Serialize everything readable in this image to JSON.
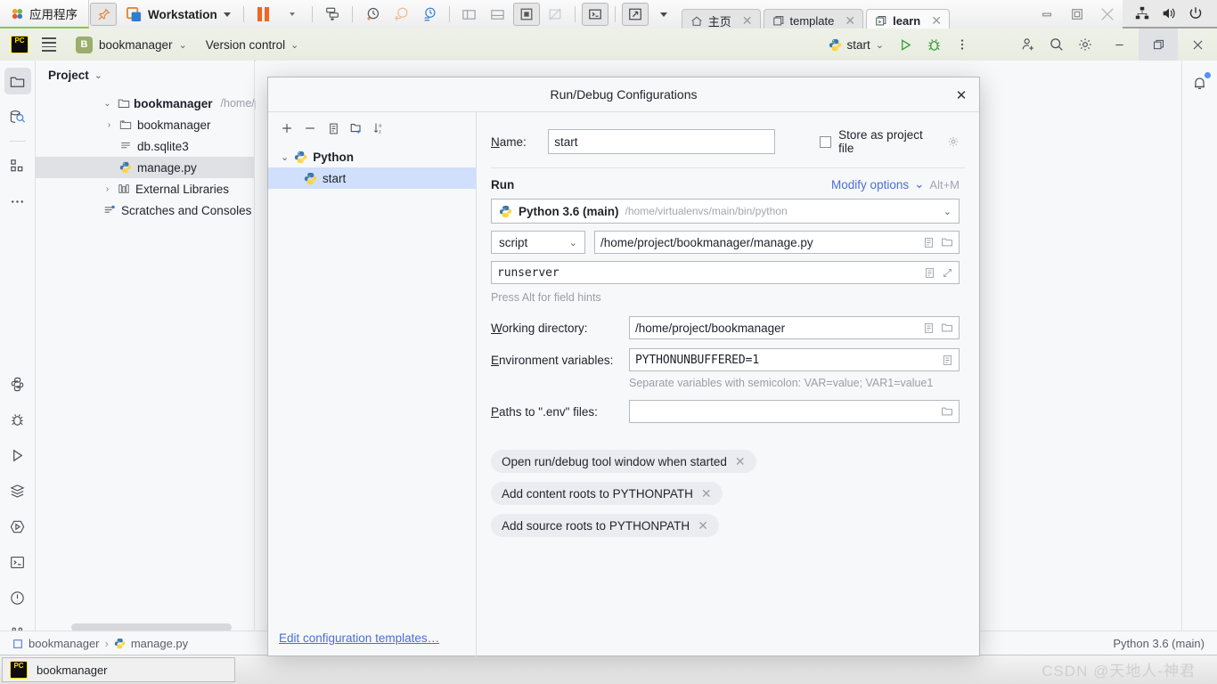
{
  "vmware": {
    "apps_label": "应用程序",
    "workstation_label": "Workstation",
    "tabs": [
      {
        "label": "主页",
        "icon": "home-icon",
        "active": false
      },
      {
        "label": "template",
        "icon": "vm-icon",
        "active": false
      },
      {
        "label": "learn",
        "icon": "vm-running-icon",
        "active": true
      }
    ]
  },
  "ide": {
    "logo_text": "PC",
    "project_badge": "B",
    "project_name": "bookmanager",
    "version_control_label": "Version control",
    "run_config_name": "start",
    "notifications_badge": true
  },
  "project_panel": {
    "title": "Project",
    "tree": [
      {
        "label": "bookmanager",
        "path": "/home/project/b",
        "icon": "folder-icon",
        "indent": 0,
        "expanded": true,
        "bold": true,
        "selected": false
      },
      {
        "label": "bookmanager",
        "path": "",
        "icon": "module-folder-icon",
        "indent": 1,
        "expanded": false,
        "bold": false,
        "selected": false
      },
      {
        "label": "db.sqlite3",
        "path": "",
        "icon": "file-icon",
        "indent": 2,
        "expanded": null,
        "bold": false,
        "selected": false
      },
      {
        "label": "manage.py",
        "path": "",
        "icon": "python-file-icon",
        "indent": 2,
        "expanded": null,
        "bold": false,
        "selected": true
      },
      {
        "label": "External Libraries",
        "path": "",
        "icon": "library-icon",
        "indent": 0,
        "expanded": false,
        "bold": false,
        "selected": false
      },
      {
        "label": "Scratches and Consoles",
        "path": "",
        "icon": "scratches-icon",
        "indent": 1,
        "expanded": null,
        "bold": false,
        "selected": false
      }
    ]
  },
  "status_bar": {
    "breadcrumb": [
      "bookmanager",
      "manage.py"
    ],
    "interpreter": "Python 3.6 (main)"
  },
  "dialog": {
    "title": "Run/Debug Configurations",
    "toolbar_icons": [
      "add-icon",
      "remove-icon",
      "copy-icon",
      "new-folder-icon",
      "sort-alphabetically-icon"
    ],
    "config_tree": [
      {
        "label": "Python",
        "bold": true,
        "selected": false,
        "child": false
      },
      {
        "label": "start",
        "bold": false,
        "selected": true,
        "child": true
      }
    ],
    "edit_templates_link": "Edit configuration templates…",
    "name_label": "Name:",
    "name_value": "start",
    "store_as_project_file_label": "Store as project file",
    "store_as_project_file_checked": false,
    "run_section_label": "Run",
    "modify_options_label": "Modify options",
    "modify_options_shortcut": "Alt+M",
    "interpreter_name": "Python 3.6 (main)",
    "interpreter_path": "/home/virtualenvs/main/bin/python",
    "target_type": "script",
    "script_path": "/home/project/bookmanager/manage.py",
    "script_arguments": "runserver",
    "field_hints": "Press Alt for field hints",
    "working_directory_label": "Working directory:",
    "working_directory_value": "/home/project/bookmanager",
    "environment_variables_label": "Environment variables:",
    "environment_variables_value": "PYTHONUNBUFFERED=1",
    "environment_hint": "Separate variables with semicolon: VAR=value; VAR1=value1",
    "paths_to_env_label": "Paths to \".env\" files:",
    "paths_to_env_value": "",
    "option_chips": [
      "Open run/debug tool window when started",
      "Add content roots to PYTHONPATH",
      "Add source roots to PYTHONPATH"
    ]
  },
  "taskbar": {
    "item_label": "bookmanager"
  },
  "watermark": "CSDN @天地人-神君",
  "colors": {
    "accent_blue": "#4a6fd4",
    "selection_blue": "#cfdffc",
    "selection_grey": "#dfe1e5",
    "python_yellow": "#ffd43b",
    "python_blue": "#3c78aa",
    "orange": "#f26522",
    "green": "#4caf50",
    "project_badge": "#9aae6d"
  }
}
